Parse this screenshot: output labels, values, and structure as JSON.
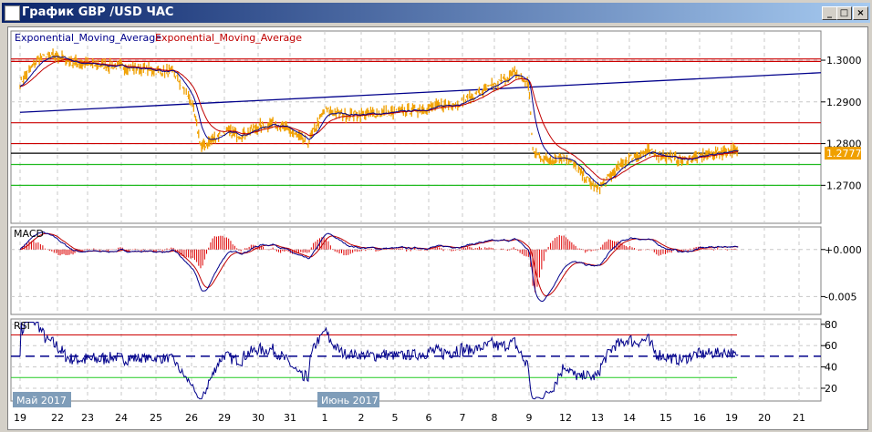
{
  "window": {
    "title": "График GBP /USD  ЧАС",
    "buttons": [
      "_",
      "□",
      "×"
    ]
  },
  "legend": {
    "ema1": "Exponential_Moving_Average",
    "ema2": "Exponential_Moving_Average",
    "ema1_color": "#00008b",
    "ema2_color": "#c00000"
  },
  "colors": {
    "price": "#f0a000",
    "support": "#22bb22",
    "resistance": "#cc0000",
    "trend": "#00008b"
  },
  "chart_data": [
    {
      "type": "line",
      "title": "GBP/USD hourly",
      "ylim": [
        1.2609,
        1.307
      ],
      "yticks": [
        "1.3000",
        "1.2900",
        "1.2800",
        "1.2700"
      ],
      "yticks_values": [
        1.3,
        1.29,
        1.28,
        1.27
      ],
      "current_price": "1.2777",
      "dates": [
        "19",
        "22",
        "23",
        "24",
        "25",
        "26",
        "29",
        "30",
        "31",
        "1",
        "2",
        "5",
        "6",
        "7",
        "8",
        "9",
        "12",
        "13",
        "14",
        "15",
        "16",
        "19",
        "20",
        "21"
      ],
      "price_keypoints": [
        [
          0,
          1.2945
        ],
        [
          0.5,
          1.3005
        ],
        [
          1,
          1.301
        ],
        [
          1.5,
          1.2995
        ],
        [
          2,
          1.299
        ],
        [
          3,
          1.2985
        ],
        [
          4,
          1.2975
        ],
        [
          4.5,
          1.297
        ],
        [
          5,
          1.29
        ],
        [
          5.3,
          1.279
        ],
        [
          6,
          1.283
        ],
        [
          6.5,
          1.282
        ],
        [
          7,
          1.284
        ],
        [
          7.5,
          1.285
        ],
        [
          8,
          1.283
        ],
        [
          8.5,
          1.28
        ],
        [
          9,
          1.288
        ],
        [
          9.5,
          1.287
        ],
        [
          10,
          1.287
        ],
        [
          11,
          1.2875
        ],
        [
          12,
          1.2885
        ],
        [
          13,
          1.29
        ],
        [
          14,
          1.294
        ],
        [
          14.6,
          1.297
        ],
        [
          15,
          1.294
        ],
        [
          15.1,
          1.278
        ],
        [
          15.5,
          1.276
        ],
        [
          16,
          1.277
        ],
        [
          16.6,
          1.272
        ],
        [
          17,
          1.269
        ],
        [
          17.5,
          1.273
        ],
        [
          18,
          1.2765
        ],
        [
          18.5,
          1.278
        ],
        [
          19,
          1.277
        ],
        [
          19.5,
          1.276
        ],
        [
          20,
          1.277
        ],
        [
          21,
          1.2785
        ],
        [
          21.2,
          1.2777
        ]
      ],
      "hlines": [
        {
          "value": 1.3003,
          "color": "red"
        },
        {
          "value": 1.2997,
          "color": "red"
        },
        {
          "value": 1.285,
          "color": "red"
        },
        {
          "value": 1.28,
          "color": "red"
        },
        {
          "value": 1.2777,
          "color": "black"
        },
        {
          "value": 1.275,
          "color": "green"
        },
        {
          "value": 1.27,
          "color": "green"
        }
      ],
      "trendline": [
        [
          0,
          1.2875
        ],
        [
          23.2,
          1.297
        ]
      ]
    },
    {
      "type": "line",
      "title": "MACD",
      "ylim": [
        -0.0069,
        0.0024
      ],
      "yticks": [
        "+0.000",
        "-0.005"
      ],
      "yticks_values": [
        0,
        -0.005
      ]
    },
    {
      "type": "line",
      "title": "RSI",
      "ylim": [
        8,
        85
      ],
      "yticks": [
        "80",
        "60",
        "40",
        "20"
      ],
      "yticks_values": [
        80,
        60,
        40,
        20
      ],
      "levels": [
        70,
        50,
        30
      ]
    }
  ],
  "month_labels": {
    "may": "Май 2017",
    "june": "Июнь 2017"
  }
}
